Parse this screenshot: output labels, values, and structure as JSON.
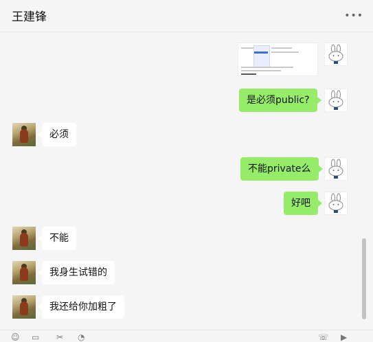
{
  "header": {
    "title": "王建锋",
    "more_icon": "more-dots-icon"
  },
  "messages": [
    {
      "from": "me",
      "type": "image",
      "desc": "screenshot"
    },
    {
      "from": "me",
      "text": "是必须public?"
    },
    {
      "from": "them",
      "text": "必须"
    },
    {
      "from": "me",
      "text": "不能private么"
    },
    {
      "from": "me",
      "text": "好吧"
    },
    {
      "from": "them",
      "text": "不能"
    },
    {
      "from": "them",
      "text": "我身生试错的"
    },
    {
      "from": "them",
      "text": "我还给你加粗了"
    }
  ],
  "footer": {
    "icons": [
      "emoji-icon",
      "file-icon",
      "scissors-icon",
      "history-icon",
      "phone-icon",
      "video-icon"
    ]
  }
}
